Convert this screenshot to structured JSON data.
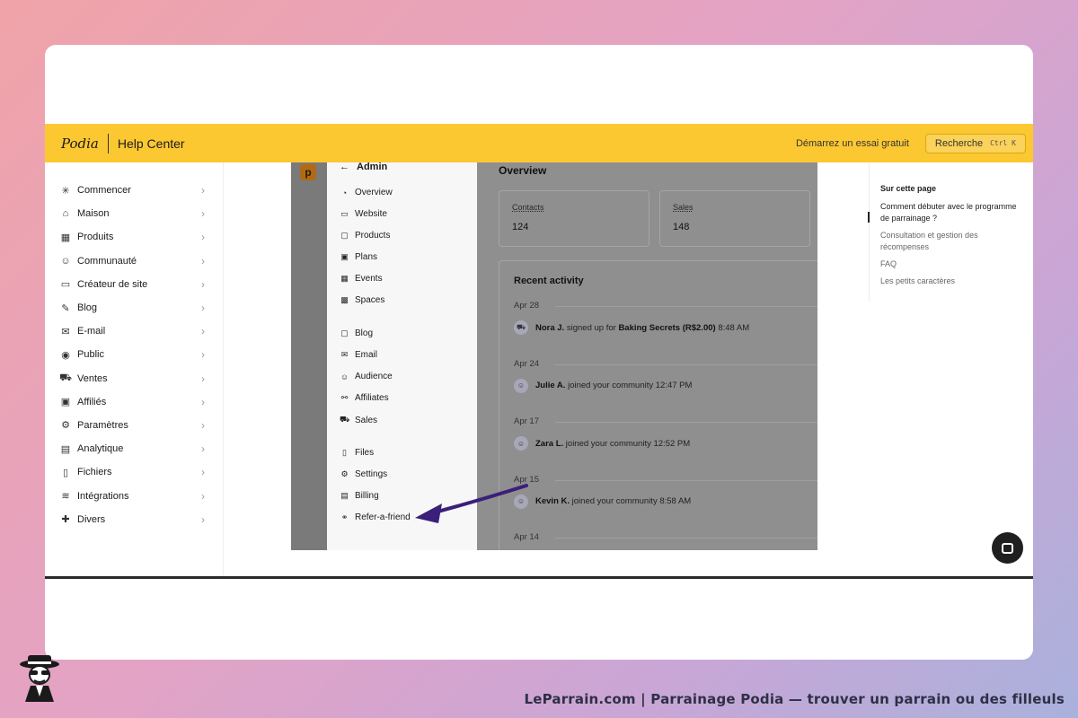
{
  "header": {
    "logo": "Podia",
    "section": "Help Center",
    "trial_link": "Démarrez un essai gratuit",
    "search_label": "Recherche",
    "search_shortcut": "Ctrl K"
  },
  "sidebar": {
    "items": [
      {
        "label": "Commencer",
        "icon": "sparkle-icon"
      },
      {
        "label": "Maison",
        "icon": "home-icon"
      },
      {
        "label": "Produits",
        "icon": "grid-icon"
      },
      {
        "label": "Communauté",
        "icon": "users-icon"
      },
      {
        "label": "Créateur de site",
        "icon": "monitor-icon"
      },
      {
        "label": "Blog",
        "icon": "edit-icon"
      },
      {
        "label": "E-mail",
        "icon": "mail-icon"
      },
      {
        "label": "Public",
        "icon": "user-circle-icon"
      },
      {
        "label": "Ventes",
        "icon": "cart-icon"
      },
      {
        "label": "Affiliés",
        "icon": "money-icon"
      },
      {
        "label": "Paramètres",
        "icon": "gear-icon"
      },
      {
        "label": "Analytique",
        "icon": "chart-icon"
      },
      {
        "label": "Fichiers",
        "icon": "folder-icon"
      },
      {
        "label": "Intégrations",
        "icon": "wifi-icon"
      },
      {
        "label": "Divers",
        "icon": "puzzle-icon"
      }
    ]
  },
  "screenshot": {
    "brand_letter": "p",
    "menu_title": "Admin",
    "menu_items": [
      "Overview",
      "Website",
      "Products",
      "Plans",
      "Events",
      "Spaces",
      "Blog",
      "Email",
      "Audience",
      "Affiliates",
      "Sales",
      "Files",
      "Settings",
      "Billing",
      "Refer-a-friend"
    ],
    "overview_title": "Overview",
    "stats": [
      {
        "label": "Contacts",
        "value": "124"
      },
      {
        "label": "Sales",
        "value": "148"
      }
    ],
    "activity_title": "Recent activity",
    "activity": [
      {
        "date": "Apr 28",
        "name": "Nora J.",
        "text": "signed up for",
        "product": "Baking Secrets (R$2.00)",
        "time": "8:48 AM"
      },
      {
        "date": "Apr 24",
        "name": "Julie A.",
        "text": "joined your community",
        "product": "",
        "time": "12:47 PM"
      },
      {
        "date": "Apr 17",
        "name": "Zara L.",
        "text": "joined your community",
        "product": "",
        "time": "12:52 PM"
      },
      {
        "date": "Apr 15",
        "name": "Kevin K.",
        "text": "joined your community",
        "product": "",
        "time": "8:58 AM"
      },
      {
        "date": "Apr 14",
        "name": "",
        "text": "",
        "product": "",
        "time": ""
      }
    ],
    "arrow_color": "#3b1f7a"
  },
  "toc": {
    "title": "Sur cette page",
    "items": [
      "Comment débuter avec le programme de parrainage ?",
      "Consultation et gestion des récompenses",
      "FAQ",
      "Les petits caractères"
    ]
  },
  "footer": {
    "caption": "LeParrain.com | Parrainage Podia — trouver un parrain ou des filleuls"
  }
}
